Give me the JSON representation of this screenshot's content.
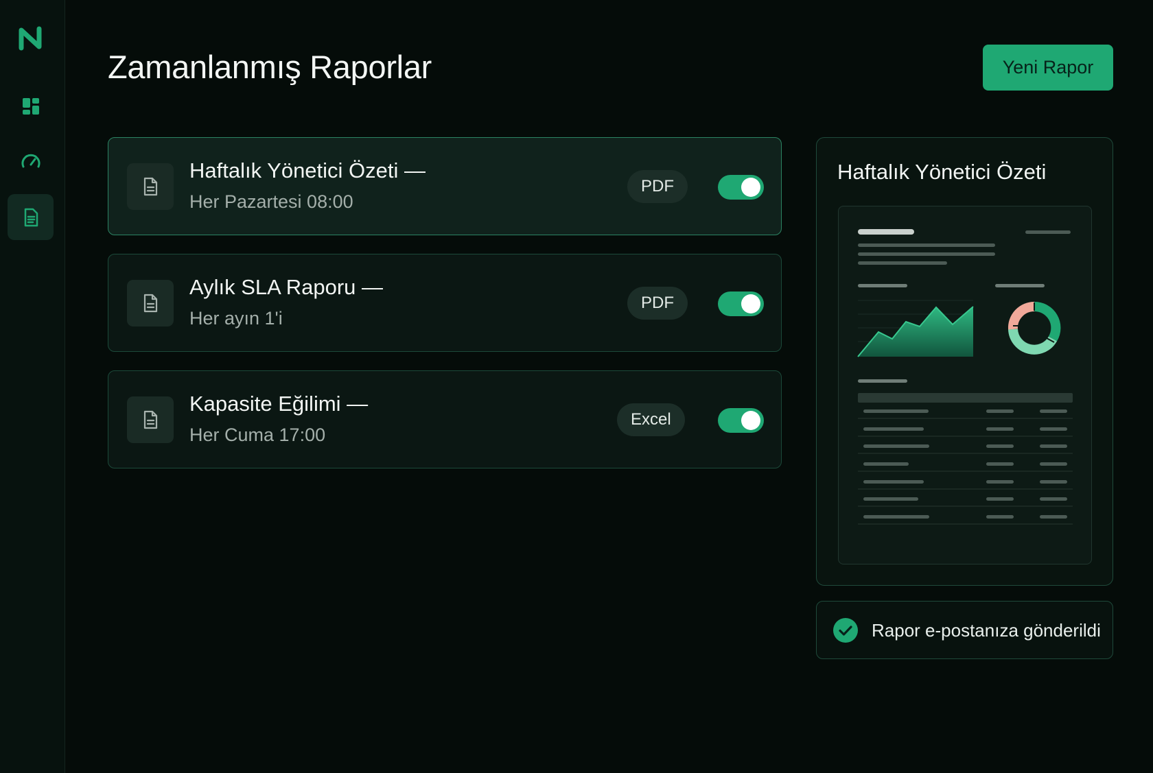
{
  "app": {
    "logo": "N",
    "colors": {
      "accent": "#1fa873",
      "background": "#050c09",
      "card_border": "#1c4a3a"
    }
  },
  "sidebar": {
    "items": [
      {
        "icon": "dashboard-icon",
        "active": false
      },
      {
        "icon": "gauge-icon",
        "active": false
      },
      {
        "icon": "document-icon",
        "active": true
      }
    ]
  },
  "header": {
    "title": "Zamanlanmış Raporlar",
    "new_button_label": "Yeni Rapor"
  },
  "reports": [
    {
      "title": "Haftalık Yönetici Özeti —",
      "schedule": "Her Pazartesi 08:00",
      "format": "PDF",
      "enabled": true,
      "selected": true
    },
    {
      "title": "Aylık SLA Raporu —",
      "schedule": "Her ayın 1'i",
      "format": "PDF",
      "enabled": true,
      "selected": false
    },
    {
      "title": "Kapasite Eğilimi —",
      "schedule": "Her Cuma 17:00",
      "format": "Excel",
      "enabled": true,
      "selected": false
    }
  ],
  "preview": {
    "title": "Haftalık Yönetici Özeti"
  },
  "toast": {
    "message": "Rapor e-postanıza gönderildi",
    "icon": "check-circle-icon"
  }
}
